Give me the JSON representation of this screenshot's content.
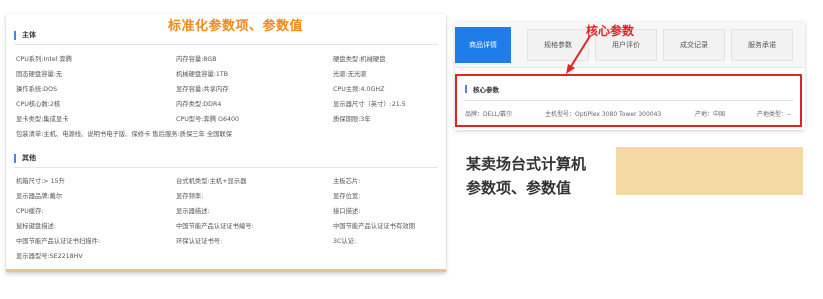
{
  "left": {
    "annotation": "标准化参数项、参数值",
    "section_main": "主体",
    "main_rows": [
      [
        "CPU系列:Intel 奔腾",
        "内存容量:8GB",
        "硬盘类型:机械硬盘"
      ],
      [
        "固态硬盘容量:无",
        "机械硬盘容量:1TB",
        "光驱:无光驱"
      ],
      [
        "操作系统:DOS",
        "显存容量:共享内存",
        "CPU主频:4.0GHZ"
      ],
      [
        "CPU核心数:2核",
        "内存类型:DDR4",
        "显示器尺寸（英寸）:21.5"
      ],
      [
        "显卡类型:集成显卡",
        "CPU型号:奔腾 G6400",
        "质保期限:3年"
      ],
      [
        "包装清单:主机、电源线、说明书电子版、保修卡 售后服务:质保三年 全国联保",
        "",
        ""
      ]
    ],
    "section_other": "其他",
    "other_rows": [
      [
        "机箱尺寸:> 15升",
        "台式机类型:主机+显示器",
        "主板芯片:"
      ],
      [
        "显示器品牌:戴尔",
        "显存频率:",
        "显存位宽:"
      ],
      [
        "CPU缓存:",
        "显示器描述:",
        "接口描述:"
      ],
      [
        "鼠标键盘描述:",
        "中国节能产品认证证书编号:",
        "中国节能产品认证证书有效期"
      ],
      [
        "中国节能产品认证证书扫描件:",
        "环保认证证书号:",
        "3C认证:"
      ],
      [
        "显示器型号:SE2218HV",
        "",
        ""
      ]
    ]
  },
  "right": {
    "annotation": "核心参数",
    "tabs": [
      "商品详情",
      "规格参数",
      "用户评价",
      "成交记录",
      "服务承诺"
    ],
    "core_title": "核心参数",
    "core_items": [
      "品牌：DELL/戴尔",
      "主机型号：OptiPlex 3080 Tower 300043",
      "产地：中国",
      "产地类型：--"
    ],
    "caption_line1": "某卖场台式计算机",
    "caption_line2": "参数项、参数值"
  },
  "colors": {
    "accent_orange": "#f08a1a",
    "accent_red": "#e02424",
    "tab_blue": "#1e7de6",
    "caption_fill": "#f5d9a5"
  }
}
